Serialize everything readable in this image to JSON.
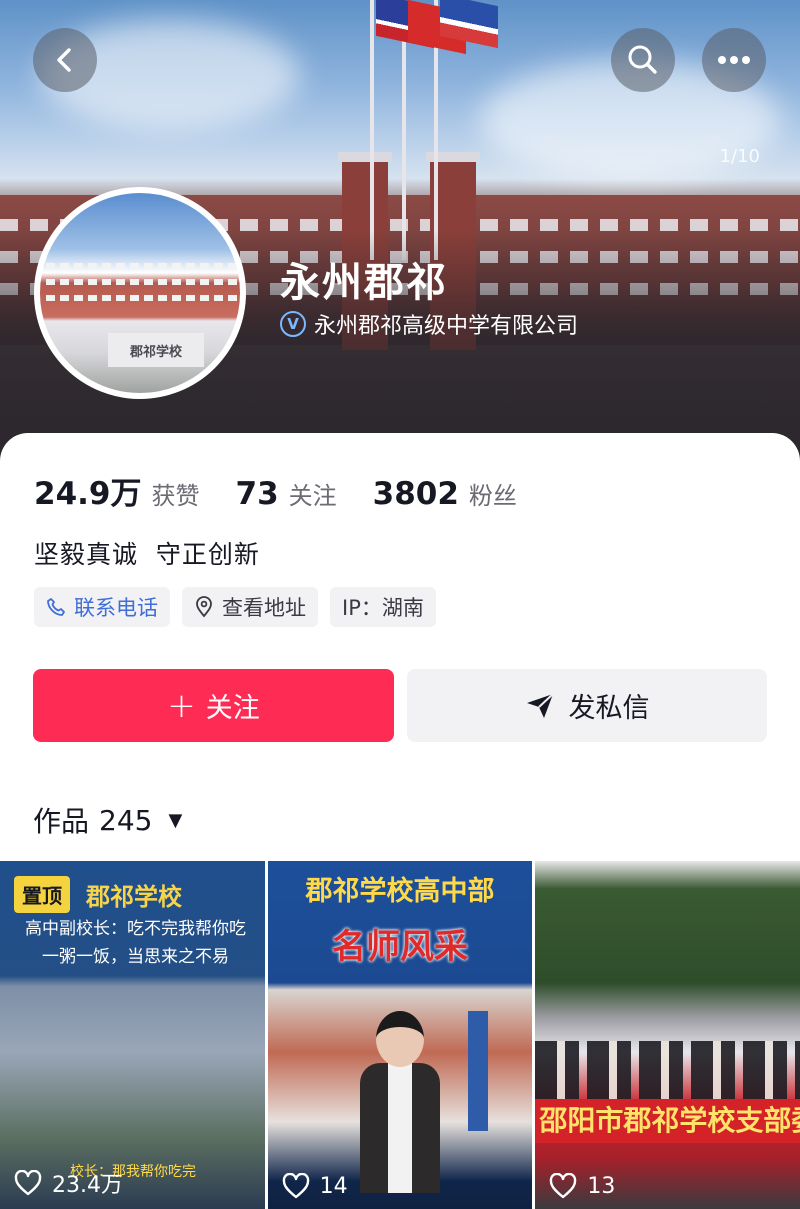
{
  "header": {
    "page_counter": "1/10",
    "back_icon": "chevron-left-icon",
    "search_icon": "search-icon",
    "more_icon": "more-horizontal-icon"
  },
  "profile": {
    "name": "永州郡祁",
    "verified_badge": "V",
    "verified_org": "永州郡祁高级中学有限公司",
    "avatar_sign_text": "郡祁学校"
  },
  "stats": {
    "likes_value": "24.9万",
    "likes_label": "获赞",
    "following_value": "73",
    "following_label": "关注",
    "followers_value": "3802",
    "followers_label": "粉丝"
  },
  "bio": "坚毅真诚  守正创新",
  "tags": {
    "phone": "联系电话",
    "address": "查看地址",
    "ip": "IP：湖南"
  },
  "actions": {
    "follow_plus": "+",
    "follow_label": "关注",
    "message_label": "发私信"
  },
  "works": {
    "label": "作品",
    "count": "245",
    "caret": "▼"
  },
  "videos": [
    {
      "pin_label": "置顶",
      "title": "郡祁学校",
      "subtitle": "高中副校长：吃不完我帮你吃 一粥一饭，当思来之不易",
      "caption": "校长：那我帮你吃完",
      "likes": "23.4万"
    },
    {
      "title": "郡祁学校高中部",
      "headline": "名师风采",
      "likes": "14"
    },
    {
      "banner": "邵阳市郡祁学校支部委",
      "likes": "13"
    }
  ],
  "colors": {
    "accent": "#fe2c55",
    "link_blue": "#3f6ed6",
    "verify_blue": "#7ab8ff",
    "pin_yellow": "#f5d33e"
  }
}
